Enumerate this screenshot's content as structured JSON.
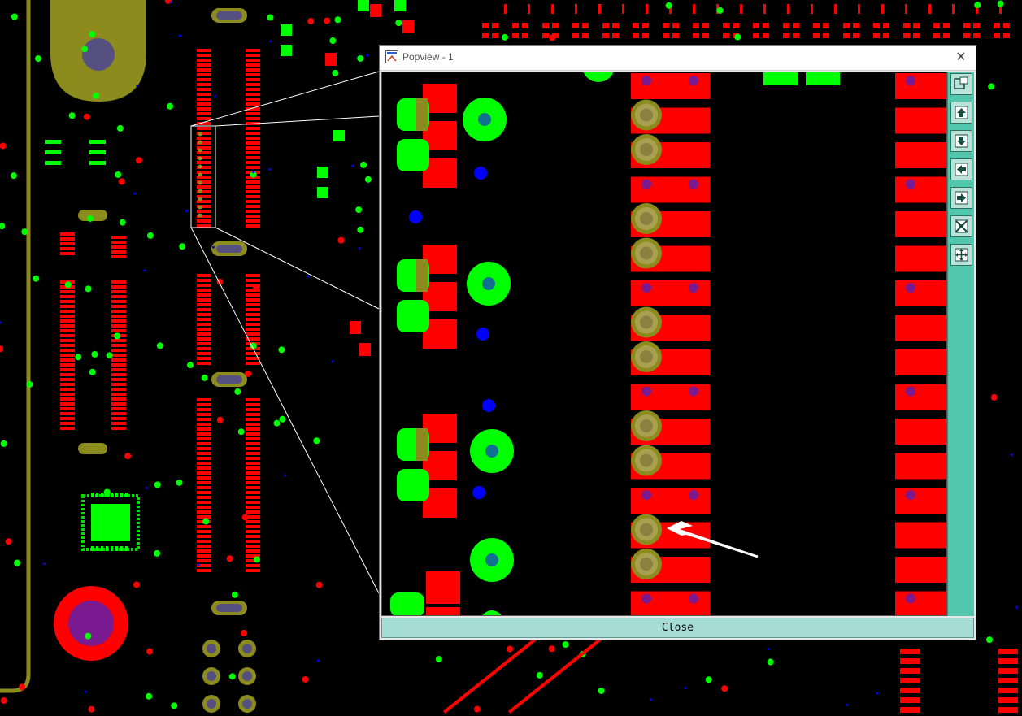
{
  "popup": {
    "title": "Popview - 1",
    "close_button_label": "Close",
    "close_glyph": "✕",
    "toolbar": [
      {
        "icon": "zoom-window-icon"
      },
      {
        "icon": "pan-up-icon"
      },
      {
        "icon": "pan-down-icon"
      },
      {
        "icon": "pan-left-icon"
      },
      {
        "icon": "pan-right-icon"
      },
      {
        "icon": "zoom-in-icon"
      },
      {
        "icon": "zoom-out-icon"
      }
    ]
  },
  "colors": {
    "pad_red": "#ff0000",
    "pad_green": "#00ff00",
    "via_blue": "#0000ff",
    "pin_olive": "#8c8c1e",
    "toolbar_teal": "#52c7ae",
    "close_bar": "#a6dcd6"
  }
}
